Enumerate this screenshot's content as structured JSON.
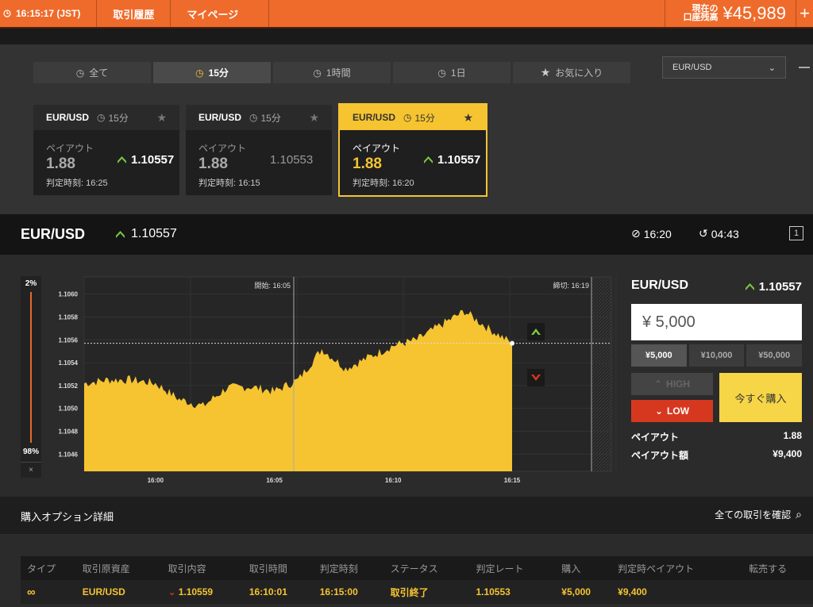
{
  "topbar": {
    "clock": "16:15:17 (JST)",
    "nav": [
      "取引履歴",
      "マイページ"
    ],
    "balance_label_1": "現在の",
    "balance_label_2": "口座残高",
    "balance": "¥45,989"
  },
  "filters": {
    "tabs": [
      "全て",
      "15分",
      "1時間",
      "1日",
      "お気に入り"
    ],
    "active_tab": "15分",
    "asset_select": "EUR/USD"
  },
  "cards": [
    {
      "pair": "EUR/USD",
      "timeframe": "15分",
      "payout_label": "ペイアウト",
      "payout": "1.88",
      "rate": "1.10557",
      "rate_direction": "up",
      "deadline": "判定時刻: 16:25"
    },
    {
      "pair": "EUR/USD",
      "timeframe": "15分",
      "payout_label": "ペイアウト",
      "payout": "1.88",
      "rate": "1.10553",
      "rate_direction": "none",
      "deadline": "判定時刻: 16:15"
    },
    {
      "pair": "EUR/USD",
      "timeframe": "15分",
      "payout_label": "ペイアウト",
      "payout": "1.88",
      "rate": "1.10557",
      "rate_direction": "up",
      "deadline": "判定時刻: 16:20",
      "selected": true
    }
  ],
  "infobar": {
    "pair": "EUR/USD",
    "rate": "1.10557",
    "expiry_time": "16:20",
    "countdown": "04:43"
  },
  "sentiment": {
    "high_pct": "2%",
    "low_pct": "98%",
    "close": "×"
  },
  "chart_data": {
    "type": "area",
    "x": [
      "15:57",
      "15:58",
      "15:59",
      "16:00",
      "16:01",
      "16:02",
      "16:03",
      "16:04",
      "16:05",
      "16:06",
      "16:07",
      "16:08",
      "16:09",
      "16:10",
      "16:11",
      "16:12",
      "16:13",
      "16:14",
      "16:15"
    ],
    "y": [
      1.10522,
      1.10525,
      1.10525,
      1.10522,
      1.10508,
      1.10502,
      1.10518,
      1.10519,
      1.10515,
      1.10525,
      1.10552,
      1.10535,
      1.10545,
      1.10555,
      1.1056,
      1.10573,
      1.10585,
      1.1057,
      1.10557
    ],
    "ylim": [
      1.10445,
      1.10615
    ],
    "yticks": [
      "1.1060",
      "1.1058",
      "1.1056",
      "1.1054",
      "1.1052",
      "1.1050",
      "1.1048",
      "1.1046"
    ],
    "ytick_values": [
      1.106,
      1.1058,
      1.1056,
      1.1054,
      1.1052,
      1.105,
      1.1048,
      1.1046
    ],
    "xticks": [
      "16:00",
      "16:05",
      "16:10",
      "16:15"
    ],
    "start_label": "開始: 16:05",
    "end_label": "締切: 16:19",
    "current_rate": 1.10557,
    "fill_color": "#f6c431"
  },
  "order": {
    "pair": "EUR/USD",
    "rate": "1.10557",
    "amount": "¥ 5,000",
    "quick_amounts": [
      "¥5,000",
      "¥10,000",
      "¥50,000"
    ],
    "high_label": "HIGH",
    "low_label": "LOW",
    "buy_label": "今すぐ購入",
    "payout_label": "ペイアウト",
    "payout": "1.88",
    "payout_amount_label": "ペイアウト額",
    "payout_amount": "¥9,400"
  },
  "details": {
    "title": "購入オプション詳細",
    "all_trades": "全ての取引を確認",
    "columns": [
      "タイプ",
      "取引原資産",
      "取引内容",
      "取引時間",
      "判定時刻",
      "ステータス",
      "判定レート",
      "購入",
      "判定時ペイアウト",
      "転売する"
    ],
    "rows": [
      {
        "asset": "EUR/USD",
        "content": "1.10559",
        "trade_time": "16:10:01",
        "deadline": "16:15:00",
        "status": "取引終了",
        "rate": "1.10553",
        "purchase": "¥5,000",
        "payout": "¥9,400",
        "resell": ""
      }
    ]
  },
  "colors": {
    "accent": "#ee6b2b",
    "yellow": "#f6c431",
    "low_red": "#d6381f",
    "up_green": "#7ac943"
  }
}
